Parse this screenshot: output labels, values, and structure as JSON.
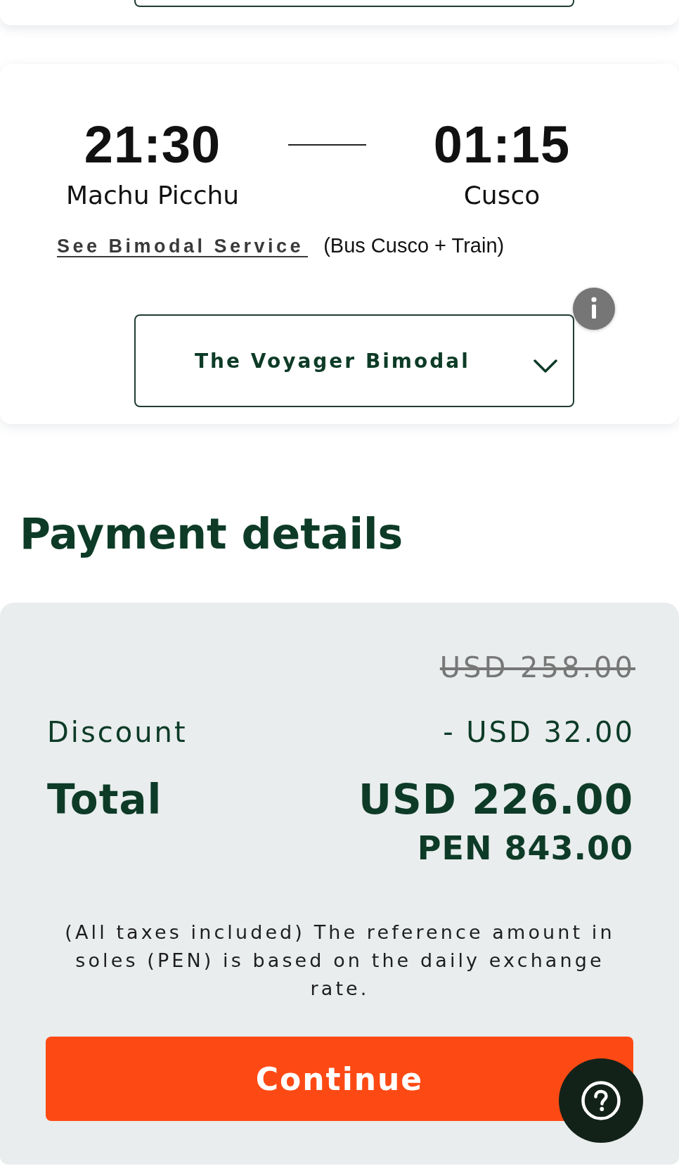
{
  "trip": {
    "departure": {
      "time": "21:30",
      "station": "Machu Picchu"
    },
    "arrival": {
      "time": "01:15",
      "station": "Cusco"
    },
    "service_link": "See Bimodal Service",
    "service_note": "(Bus Cusco + Train)",
    "class_dropdown": {
      "value": "The Voyager Bimodal"
    }
  },
  "payment_details": {
    "title": "Payment details",
    "original_price": {
      "amount": "USD 258.00",
      "struck": true
    },
    "discount": {
      "label": "Discount",
      "amount": "- USD 32.00"
    },
    "total": {
      "label": "Total",
      "amount": "USD 226.00",
      "amount_pen": "PEN 843.00"
    },
    "note": "(All taxes included) The reference amount in soles (PEN) is based on the daily exchange rate.",
    "continue_button": "Continue"
  }
}
